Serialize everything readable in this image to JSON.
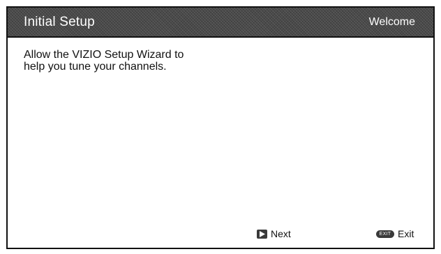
{
  "header": {
    "title": "Initial Setup",
    "step_label": "Welcome"
  },
  "main": {
    "message_line1": "Allow the VIZIO Setup Wizard to",
    "message_line2": "help you tune your channels."
  },
  "footer": {
    "next_label": "Next",
    "exit_key_text": "EXIT",
    "exit_label": "Exit",
    "next_icon": "play-arrow-icon",
    "exit_icon": "exit-key-icon"
  },
  "colors": {
    "title_bar": "#4a4a4a",
    "title_text": "#ffffff",
    "body_text": "#111111",
    "background": "#ffffff"
  }
}
